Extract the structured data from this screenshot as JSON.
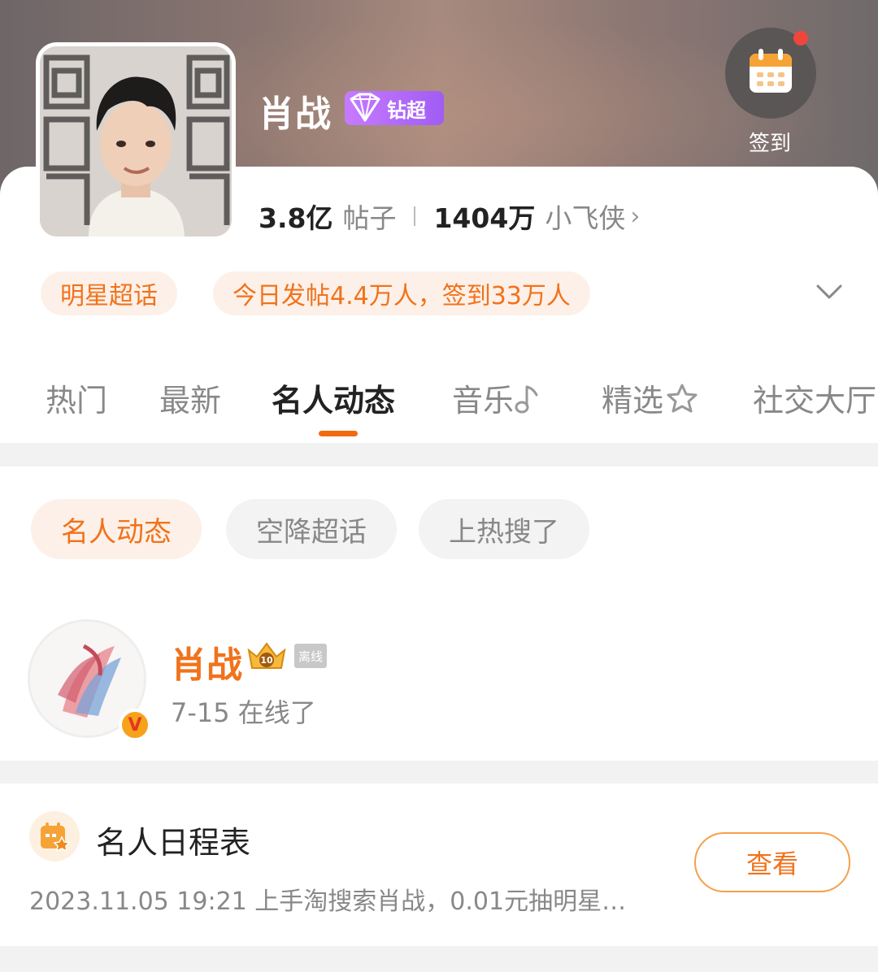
{
  "header": {
    "name": "肖战",
    "badge_label": "钻超",
    "checkin_label": "签到"
  },
  "stats": {
    "posts_value": "3.8亿",
    "posts_label": "帖子",
    "fans_value": "1404万",
    "fans_label": "小飞侠"
  },
  "tags": {
    "category": "明星超话",
    "activity": "今日发帖4.4万人，签到33万人"
  },
  "tabs": [
    {
      "label": "热门"
    },
    {
      "label": "最新"
    },
    {
      "label": "名人动态"
    },
    {
      "label": "音乐"
    },
    {
      "label": "精选"
    },
    {
      "label": "社交大厅"
    }
  ],
  "filters": [
    {
      "label": "名人动态"
    },
    {
      "label": "空降超话"
    },
    {
      "label": "上热搜了"
    }
  ],
  "celebrity": {
    "name": "肖战",
    "offline_badge": "离线",
    "status": "7-15 在线了",
    "verified_mark": "V"
  },
  "schedule": {
    "title": "名人日程表",
    "description": "2023.11.05 19:21 上手淘搜索肖战，0.01元抽明星…",
    "button_label": "查看"
  },
  "colors": {
    "accent": "#f0731c",
    "badge_purple": "#a15cf3",
    "notification_dot": "#f0453a"
  }
}
